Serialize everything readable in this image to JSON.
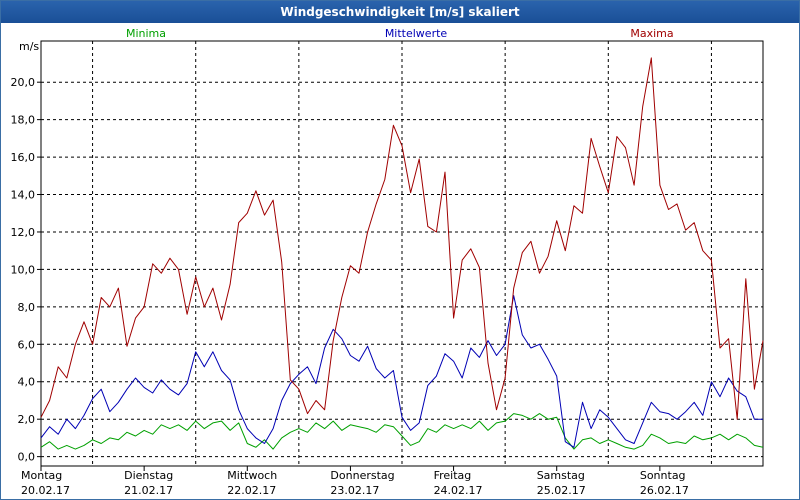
{
  "window": {
    "title": "Windgeschwindigkeit [m/s] skaliert"
  },
  "chart_data": {
    "type": "line",
    "title": "Windgeschwindigkeit [m/s] skaliert",
    "ylabel": "m/s",
    "ylim": [
      -0.5,
      22.2
    ],
    "yticks": [
      "0,0",
      "2,0",
      "4,0",
      "6,0",
      "8,0",
      "10,0",
      "12,0",
      "14,0",
      "16,0",
      "18,0",
      "20,0"
    ],
    "xlim": [
      0,
      168
    ],
    "days": [
      {
        "day": "Montag",
        "date": "20.02.17"
      },
      {
        "day": "Dienstag",
        "date": "21.02.17"
      },
      {
        "day": "Mittwoch",
        "date": "22.02.17"
      },
      {
        "day": "Donnerstag",
        "date": "23.02.17"
      },
      {
        "day": "Freitag",
        "date": "24.02.17"
      },
      {
        "day": "Samstag",
        "date": "25.02.17"
      },
      {
        "day": "Sonntag",
        "date": "26.02.17"
      }
    ],
    "grid": true,
    "series": [
      {
        "name": "Minima",
        "color": "#00a000",
        "points": [
          [
            0,
            0.5
          ],
          [
            2,
            0.8
          ],
          [
            4,
            0.4
          ],
          [
            6,
            0.6
          ],
          [
            8,
            0.4
          ],
          [
            10,
            0.6
          ],
          [
            12,
            0.9
          ],
          [
            14,
            0.7
          ],
          [
            16,
            1.0
          ],
          [
            18,
            0.9
          ],
          [
            20,
            1.3
          ],
          [
            22,
            1.1
          ],
          [
            24,
            1.4
          ],
          [
            26,
            1.2
          ],
          [
            28,
            1.7
          ],
          [
            30,
            1.5
          ],
          [
            32,
            1.7
          ],
          [
            34,
            1.4
          ],
          [
            36,
            1.9
          ],
          [
            38,
            1.5
          ],
          [
            40,
            1.8
          ],
          [
            42,
            1.9
          ],
          [
            44,
            1.4
          ],
          [
            46,
            1.8
          ],
          [
            48,
            0.7
          ],
          [
            50,
            0.5
          ],
          [
            52,
            0.9
          ],
          [
            54,
            0.4
          ],
          [
            56,
            1.0
          ],
          [
            58,
            1.3
          ],
          [
            60,
            1.5
          ],
          [
            62,
            1.3
          ],
          [
            64,
            1.8
          ],
          [
            66,
            1.5
          ],
          [
            68,
            1.9
          ],
          [
            70,
            1.4
          ],
          [
            72,
            1.7
          ],
          [
            74,
            1.6
          ],
          [
            76,
            1.5
          ],
          [
            78,
            1.3
          ],
          [
            80,
            1.7
          ],
          [
            82,
            1.6
          ],
          [
            84,
            1.1
          ],
          [
            86,
            0.6
          ],
          [
            88,
            0.8
          ],
          [
            90,
            1.5
          ],
          [
            92,
            1.3
          ],
          [
            94,
            1.7
          ],
          [
            96,
            1.5
          ],
          [
            98,
            1.7
          ],
          [
            100,
            1.5
          ],
          [
            102,
            1.9
          ],
          [
            104,
            1.4
          ],
          [
            106,
            1.8
          ],
          [
            108,
            1.9
          ],
          [
            110,
            2.3
          ],
          [
            112,
            2.2
          ],
          [
            114,
            2.0
          ],
          [
            116,
            2.3
          ],
          [
            118,
            2.0
          ],
          [
            120,
            2.1
          ],
          [
            122,
            1.0
          ],
          [
            124,
            0.4
          ],
          [
            126,
            0.9
          ],
          [
            128,
            1.0
          ],
          [
            130,
            0.7
          ],
          [
            132,
            0.9
          ],
          [
            134,
            0.7
          ],
          [
            136,
            0.5
          ],
          [
            138,
            0.4
          ],
          [
            140,
            0.6
          ],
          [
            142,
            1.2
          ],
          [
            144,
            1.0
          ],
          [
            146,
            0.7
          ],
          [
            148,
            0.8
          ],
          [
            150,
            0.7
          ],
          [
            152,
            1.1
          ],
          [
            154,
            0.9
          ],
          [
            156,
            1.0
          ],
          [
            158,
            1.2
          ],
          [
            160,
            0.9
          ],
          [
            162,
            1.2
          ],
          [
            164,
            1.0
          ],
          [
            166,
            0.6
          ],
          [
            168,
            0.5
          ]
        ]
      },
      {
        "name": "Mittelwerte",
        "color": "#0000b4",
        "points": [
          [
            0,
            1.0
          ],
          [
            2,
            1.6
          ],
          [
            4,
            1.2
          ],
          [
            6,
            2.0
          ],
          [
            8,
            1.5
          ],
          [
            10,
            2.2
          ],
          [
            12,
            3.1
          ],
          [
            14,
            3.6
          ],
          [
            16,
            2.4
          ],
          [
            18,
            2.9
          ],
          [
            20,
            3.6
          ],
          [
            22,
            4.2
          ],
          [
            24,
            3.7
          ],
          [
            26,
            3.4
          ],
          [
            28,
            4.1
          ],
          [
            30,
            3.6
          ],
          [
            32,
            3.3
          ],
          [
            34,
            3.9
          ],
          [
            36,
            5.6
          ],
          [
            38,
            4.8
          ],
          [
            40,
            5.6
          ],
          [
            42,
            4.6
          ],
          [
            44,
            4.1
          ],
          [
            46,
            2.5
          ],
          [
            48,
            1.5
          ],
          [
            50,
            1.0
          ],
          [
            52,
            0.7
          ],
          [
            54,
            1.5
          ],
          [
            56,
            3.0
          ],
          [
            58,
            3.9
          ],
          [
            60,
            4.4
          ],
          [
            62,
            4.8
          ],
          [
            64,
            3.9
          ],
          [
            66,
            5.8
          ],
          [
            68,
            6.8
          ],
          [
            70,
            6.3
          ],
          [
            72,
            5.4
          ],
          [
            74,
            5.1
          ],
          [
            76,
            5.9
          ],
          [
            78,
            4.7
          ],
          [
            80,
            4.2
          ],
          [
            82,
            4.6
          ],
          [
            84,
            2.1
          ],
          [
            86,
            1.4
          ],
          [
            88,
            1.8
          ],
          [
            90,
            3.8
          ],
          [
            92,
            4.3
          ],
          [
            94,
            5.5
          ],
          [
            96,
            5.1
          ],
          [
            98,
            4.2
          ],
          [
            100,
            5.8
          ],
          [
            102,
            5.3
          ],
          [
            104,
            6.2
          ],
          [
            106,
            5.4
          ],
          [
            108,
            6.0
          ],
          [
            110,
            8.6
          ],
          [
            112,
            6.5
          ],
          [
            114,
            5.8
          ],
          [
            116,
            6.0
          ],
          [
            118,
            5.2
          ],
          [
            120,
            4.3
          ],
          [
            122,
            0.8
          ],
          [
            124,
            0.5
          ],
          [
            126,
            2.9
          ],
          [
            128,
            1.5
          ],
          [
            130,
            2.5
          ],
          [
            132,
            2.1
          ],
          [
            134,
            1.5
          ],
          [
            136,
            0.9
          ],
          [
            138,
            0.7
          ],
          [
            140,
            1.8
          ],
          [
            142,
            2.9
          ],
          [
            144,
            2.4
          ],
          [
            146,
            2.3
          ],
          [
            148,
            2.0
          ],
          [
            150,
            2.4
          ],
          [
            152,
            2.9
          ],
          [
            154,
            2.2
          ],
          [
            156,
            4.0
          ],
          [
            158,
            3.2
          ],
          [
            160,
            4.2
          ],
          [
            162,
            3.5
          ],
          [
            164,
            3.2
          ],
          [
            166,
            2.0
          ],
          [
            168,
            2.0
          ]
        ]
      },
      {
        "name": "Maxima",
        "color": "#a00000",
        "points": [
          [
            0,
            2.1
          ],
          [
            2,
            3.0
          ],
          [
            4,
            4.8
          ],
          [
            6,
            4.2
          ],
          [
            8,
            6.0
          ],
          [
            10,
            7.2
          ],
          [
            12,
            6.0
          ],
          [
            14,
            8.5
          ],
          [
            16,
            8.0
          ],
          [
            18,
            9.0
          ],
          [
            20,
            5.9
          ],
          [
            22,
            7.4
          ],
          [
            24,
            8.0
          ],
          [
            26,
            10.3
          ],
          [
            28,
            9.8
          ],
          [
            30,
            10.6
          ],
          [
            32,
            10.0
          ],
          [
            34,
            7.6
          ],
          [
            36,
            9.6
          ],
          [
            38,
            8.0
          ],
          [
            40,
            9.0
          ],
          [
            42,
            7.3
          ],
          [
            44,
            9.2
          ],
          [
            46,
            12.5
          ],
          [
            48,
            13.0
          ],
          [
            50,
            14.2
          ],
          [
            52,
            12.9
          ],
          [
            54,
            13.7
          ],
          [
            56,
            10.4
          ],
          [
            58,
            4.1
          ],
          [
            60,
            3.6
          ],
          [
            62,
            2.3
          ],
          [
            64,
            3.0
          ],
          [
            66,
            2.5
          ],
          [
            68,
            6.2
          ],
          [
            70,
            8.5
          ],
          [
            72,
            10.2
          ],
          [
            74,
            9.8
          ],
          [
            76,
            12.0
          ],
          [
            78,
            13.5
          ],
          [
            80,
            14.8
          ],
          [
            82,
            17.7
          ],
          [
            84,
            16.6
          ],
          [
            86,
            14.1
          ],
          [
            88,
            15.9
          ],
          [
            90,
            12.3
          ],
          [
            92,
            12.0
          ],
          [
            94,
            15.2
          ],
          [
            96,
            7.4
          ],
          [
            98,
            10.5
          ],
          [
            100,
            11.1
          ],
          [
            102,
            10.1
          ],
          [
            104,
            5.0
          ],
          [
            106,
            2.5
          ],
          [
            108,
            4.2
          ],
          [
            110,
            9.0
          ],
          [
            112,
            10.9
          ],
          [
            114,
            11.5
          ],
          [
            116,
            9.8
          ],
          [
            118,
            10.7
          ],
          [
            120,
            12.6
          ],
          [
            122,
            11.0
          ],
          [
            124,
            13.4
          ],
          [
            126,
            13.0
          ],
          [
            128,
            17.0
          ],
          [
            130,
            15.5
          ],
          [
            132,
            14.1
          ],
          [
            134,
            17.1
          ],
          [
            136,
            16.5
          ],
          [
            138,
            14.5
          ],
          [
            140,
            18.7
          ],
          [
            142,
            21.3
          ],
          [
            144,
            14.5
          ],
          [
            146,
            13.2
          ],
          [
            148,
            13.5
          ],
          [
            150,
            12.1
          ],
          [
            152,
            12.5
          ],
          [
            154,
            11.0
          ],
          [
            156,
            10.5
          ],
          [
            158,
            5.8
          ],
          [
            160,
            6.3
          ],
          [
            162,
            2.0
          ],
          [
            164,
            9.5
          ],
          [
            166,
            3.6
          ],
          [
            168,
            6.2
          ]
        ]
      }
    ]
  }
}
